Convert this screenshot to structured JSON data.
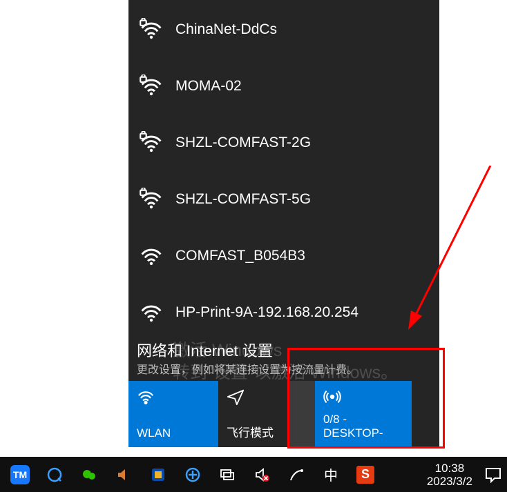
{
  "networks": [
    {
      "name": "ChinaNet-DdCs",
      "secured": true
    },
    {
      "name": "MOMA-02",
      "secured": true
    },
    {
      "name": "SHZL-COMFAST-2G",
      "secured": true
    },
    {
      "name": "SHZL-COMFAST-5G",
      "secured": true
    },
    {
      "name": "COMFAST_B054B3",
      "secured": false
    },
    {
      "name": "HP-Print-9A-192.168.20.254",
      "secured": false
    }
  ],
  "settings": {
    "title": "网络和 Internet 设置",
    "subtitle": "更改设置，例如将某连接设置为按流量计费。"
  },
  "tiles": {
    "wlan": {
      "label": "WLAN"
    },
    "airplane": {
      "label": "飞行模式"
    },
    "hotspot": {
      "line1": "0/8 -",
      "line2": "DESKTOP-"
    }
  },
  "watermark": {
    "l1": "激活 Windows",
    "l2": "转到\"设置\"以激活 Windows。"
  },
  "clock": {
    "time": "10:38",
    "date": "2023/3/2"
  },
  "ime": {
    "lang": "中",
    "badge": "S"
  },
  "tm": "TM"
}
